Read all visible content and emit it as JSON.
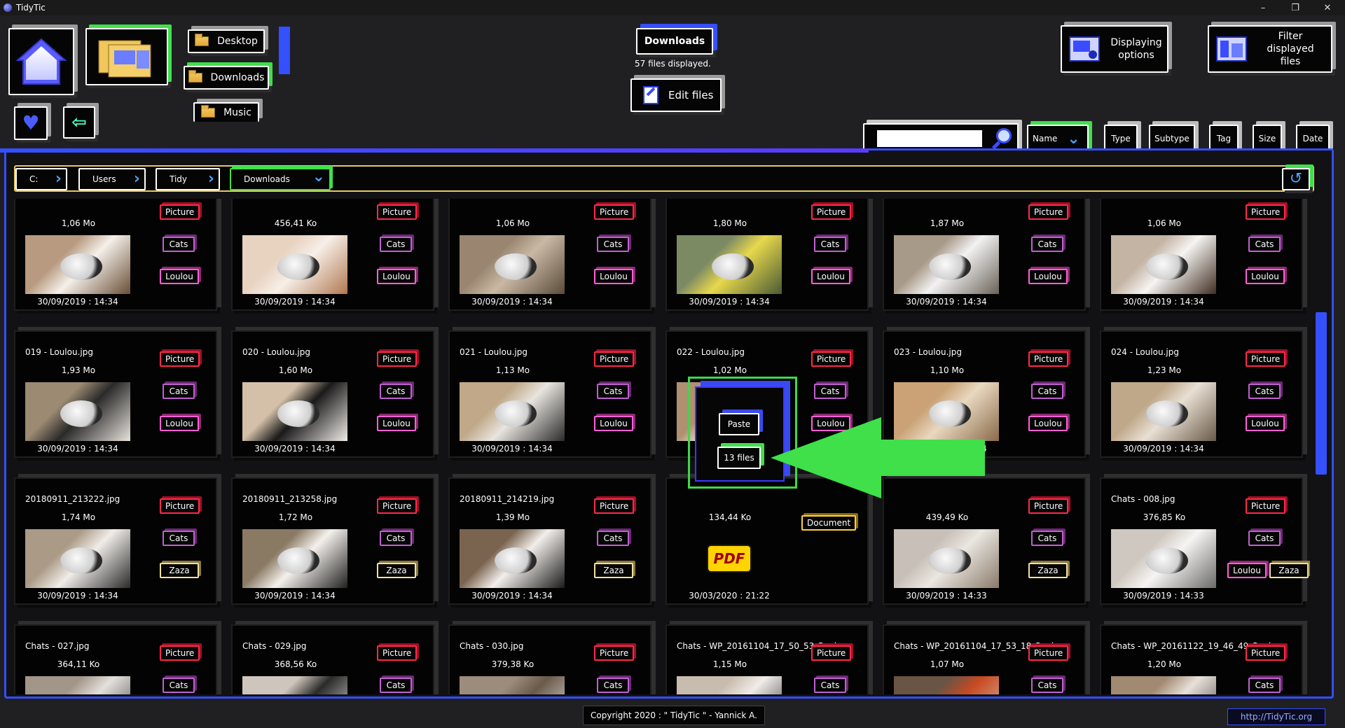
{
  "app": {
    "title": "TidyTic",
    "window_controls": {
      "minimize": "–",
      "maximize": "❐",
      "close": "✕"
    }
  },
  "nav": {
    "desktop": "Desktop",
    "downloads": "Downloads",
    "music": "Music"
  },
  "current": {
    "folder": "Downloads",
    "count_text": "57 files displayed.",
    "edit": "Edit files"
  },
  "top_right": {
    "display": "Displaying options",
    "filter": "Filter displayed files"
  },
  "search": {
    "value": ""
  },
  "sort": {
    "name": "Name",
    "type": "Type",
    "subtype": "Subtype",
    "tag": "Tag",
    "size": "Size",
    "date": "Date"
  },
  "breadcrumb": [
    "C:",
    "Users",
    "Tidy",
    "Downloads"
  ],
  "files": [
    {
      "name": "",
      "size": "1,06 Mo",
      "date": "30/09/2019 : 14:34",
      "tags": [
        "Picture",
        "Cats",
        "Loulou"
      ]
    },
    {
      "name": "",
      "size": "456,41 Ko",
      "date": "30/09/2019 : 14:34",
      "tags": [
        "Picture",
        "Cats",
        "Loulou"
      ]
    },
    {
      "name": "",
      "size": "1,06 Mo",
      "date": "30/09/2019 : 14:34",
      "tags": [
        "Picture",
        "Cats",
        "Loulou"
      ]
    },
    {
      "name": "",
      "size": "1,80 Mo",
      "date": "30/09/2019 : 14:34",
      "tags": [
        "Picture",
        "Cats",
        "Loulou"
      ]
    },
    {
      "name": "",
      "size": "1,87 Mo",
      "date": "30/09/2019 : 14:34",
      "tags": [
        "Picture",
        "Cats",
        "Loulou"
      ]
    },
    {
      "name": "",
      "size": "1,06 Mo",
      "date": "30/09/2019 : 14:34",
      "tags": [
        "Picture",
        "Cats",
        "Loulou"
      ]
    },
    {
      "name": "019 - Loulou.jpg",
      "size": "1,93 Mo",
      "date": "30/09/2019 : 14:34",
      "tags": [
        "Picture",
        "Cats",
        "Loulou"
      ]
    },
    {
      "name": "020 - Loulou.jpg",
      "size": "1,60 Mo",
      "date": "30/09/2019 : 14:34",
      "tags": [
        "Picture",
        "Cats",
        "Loulou"
      ]
    },
    {
      "name": "021 - Loulou.jpg",
      "size": "1,13 Mo",
      "date": "30/09/2019 : 14:34",
      "tags": [
        "Picture",
        "Cats",
        "Loulou"
      ]
    },
    {
      "name": "022 - Loulou.jpg",
      "size": "1,02 Mo",
      "date": "",
      "tags": [
        "Picture",
        "Cats",
        "Loulou"
      ]
    },
    {
      "name": "023 - Loulou.jpg",
      "size": "1,10 Mo",
      "date": "30/09/2019 : 14:34",
      "tags": [
        "Picture",
        "Cats",
        "Loulou"
      ]
    },
    {
      "name": "024 - Loulou.jpg",
      "size": "1,23 Mo",
      "date": "30/09/2019 : 14:34",
      "tags": [
        "Picture",
        "Cats",
        "Loulou"
      ]
    },
    {
      "name": "20180911_213222.jpg",
      "size": "1,74 Mo",
      "date": "30/09/2019 : 14:34",
      "tags": [
        "Picture",
        "Cats",
        "Zaza"
      ]
    },
    {
      "name": "20180911_213258.jpg",
      "size": "1,72 Mo",
      "date": "30/09/2019 : 14:34",
      "tags": [
        "Picture",
        "Cats",
        "Zaza"
      ]
    },
    {
      "name": "20180911_214219.jpg",
      "size": "1,39 Mo",
      "date": "30/09/2019 : 14:34",
      "tags": [
        "Picture",
        "Cats",
        "Zaza"
      ]
    },
    {
      "name": "",
      "size": "134,44 Ko",
      "date": "30/03/2020 : 21:22",
      "tags": [
        "Document"
      ],
      "pdf": true
    },
    {
      "name": "",
      "size": "439,49 Ko",
      "date": "30/09/2019 : 14:33",
      "tags": [
        "Picture",
        "Cats",
        "Zaza"
      ]
    },
    {
      "name": "Chats - 008.jpg",
      "size": "376,85 Ko",
      "date": "30/09/2019 : 14:33",
      "tags": [
        "Picture",
        "Cats",
        "Loulou",
        "Zaza"
      ]
    },
    {
      "name": "Chats - 027.jpg",
      "size": "364,11 Ko",
      "date": "",
      "tags": [
        "Picture",
        "Cats"
      ]
    },
    {
      "name": "Chats - 029.jpg",
      "size": "368,56 Ko",
      "date": "",
      "tags": [
        "Picture",
        "Cats"
      ]
    },
    {
      "name": "Chats - 030.jpg",
      "size": "379,38 Ko",
      "date": "",
      "tags": [
        "Picture",
        "Cats"
      ]
    },
    {
      "name": "Chats - WP_20161104_17_50_53_Pro.jpg",
      "size": "1,15 Mo",
      "date": "",
      "tags": [
        "Picture",
        "Cats"
      ]
    },
    {
      "name": "Chats - WP_20161104_17_53_18_Pro.jpg",
      "size": "1,07 Mo",
      "date": "",
      "tags": [
        "Picture",
        "Cats"
      ]
    },
    {
      "name": "Chats - WP_20161122_19_46_49_Pro.jpg",
      "size": "1,20 Mo",
      "date": "",
      "tags": [
        "Picture",
        "Cats"
      ]
    }
  ],
  "pdf_label": "PDF",
  "popup": {
    "paste": "Paste",
    "count": "13 files"
  },
  "footer": {
    "copyright": "Copyright 2020 : \" TidyTic \" - Yannick A.",
    "link": "http://TidyTic.org"
  },
  "colors": {
    "accent": "#3450ff",
    "green": "#3fe04a",
    "picture_tag": "#ff2a4a",
    "document_tag": "#ffd040"
  }
}
